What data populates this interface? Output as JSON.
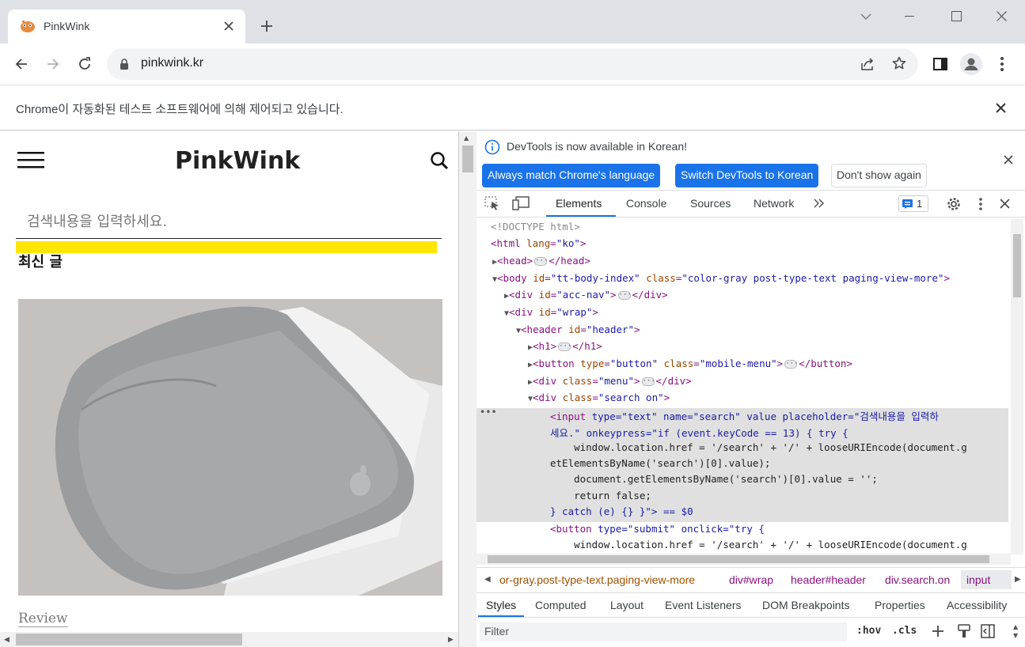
{
  "tab": {
    "title": "PinkWink",
    "favicon": "pinkwink-favicon"
  },
  "omnibox": {
    "url": "pinkwink.kr"
  },
  "infobar": {
    "message": "Chrome이 자동화된 테스트 소프트웨어에 의해 제어되고 있습니다."
  },
  "site": {
    "logo": "PinkWink",
    "search_placeholder": "검색내용을 입력하세요.",
    "section_title": "최신 글",
    "post_category": "Review",
    "accent_color": "#ffe600"
  },
  "devtools": {
    "notice": "DevTools is now available in Korean!",
    "btn_match": "Always match Chrome's language",
    "btn_switch": "Switch DevTools to Korean",
    "btn_dont": "Don't show again",
    "tabs": [
      "Elements",
      "Console",
      "Sources",
      "Network"
    ],
    "issues_count": "1",
    "code": {
      "l1": "<!DOCTYPE html>",
      "l2_tag": "<html ",
      "l2_attr": "lang",
      "l2_val": "\"ko\"",
      "l2_end": ">",
      "l3a": "<head>",
      "l3b": "</head>",
      "l4_tag": "<body ",
      "l4_a1": "id",
      "l4_v1": "\"tt-body-index\"",
      "l4_a2": "class",
      "l4_v2": "\"color-gray post-type-text paging-view-more\"",
      "l5_a": "id",
      "l5_v": "\"acc-nav\"",
      "l6_a": "id",
      "l6_v": "\"wrap\"",
      "l7_a": "id",
      "l7_v": "\"header\"",
      "l9_a1": "type",
      "l9_v1": "\"button\"",
      "l9_a2": "class",
      "l9_v2": "\"mobile-menu\"",
      "l10_a": "class",
      "l10_v": "\"menu\"",
      "l11_a": "class",
      "l11_v": "\"search on\"",
      "s1": "type=\"text\" name=\"search\" value placeholder=\"검색내용을 입력하",
      "s2": "세요.\" onkeypress=\"if (event.keyCode == 13) { try {",
      "s3": "    window.location.href = '/search' + '/' + looseURIEncode(document.g",
      "s4": "etElementsByName('search')[0].value);",
      "s5": "    document.getElementsByName('search')[0].value = '';",
      "s6": "    return false;",
      "s7": "} catch (e) {} }\"> == $0",
      "b1": "type=\"submit\" onclick=\"try {",
      "b2": "    window.location.href = '/search' + '/' + looseURIEncode(document.g"
    },
    "breadcrumbs": [
      "or-gray.post-type-text.paging-view-more",
      "div#wrap",
      "header#header",
      "div.search.on",
      "input"
    ],
    "bottom_tabs": [
      "Styles",
      "Computed",
      "Layout",
      "Event Listeners",
      "DOM Breakpoints",
      "Properties",
      "Accessibility"
    ],
    "filter_placeholder": "Filter",
    "hov": ":hov",
    "cls": ".cls"
  }
}
